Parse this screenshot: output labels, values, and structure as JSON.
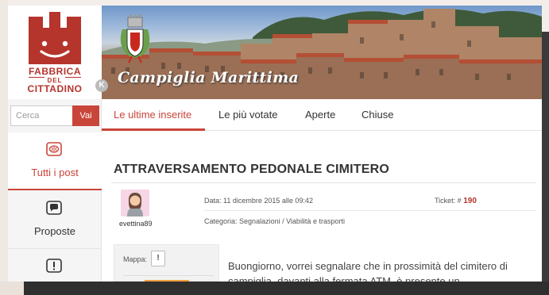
{
  "logo": {
    "line1": "FABBRICA",
    "line2": "DEL",
    "line3": "CITTADINO"
  },
  "banner": {
    "title": "Campiglia Marittima",
    "collapse_icon": "K"
  },
  "search": {
    "placeholder": "Cerca",
    "button": "Vai"
  },
  "sidebar": {
    "items": [
      {
        "label": "Tutti i post",
        "icon": "brain-icon"
      },
      {
        "label": "Proposte",
        "icon": "speech-bubble-icon"
      },
      {
        "label": "",
        "icon": "exclamation-icon"
      }
    ]
  },
  "tabs": [
    "Le ultime inserite",
    "Le più votate",
    "Aperte",
    "Chiuse"
  ],
  "post": {
    "title": "ATTRAVERSAMENTO PEDONALE CIMITERO",
    "user": "evettina89",
    "date_label": "Data:",
    "date_value": "11 dicembre 2015 alle 09:42",
    "ticket_label": "Ticket: #",
    "ticket_number": "190",
    "category_label": "Categoria:",
    "category_value": "Segnalazioni / Viabilità e trasporti",
    "map_label": "Mappa:",
    "map_icon": "!",
    "body": "Buongiorno, vorrei segnalare che in prossimità del cimitero di campiglia, davanti alla fermata ATM, è presente un"
  },
  "colors": {
    "accent": "#c9453a",
    "brand": "#b5342c"
  }
}
